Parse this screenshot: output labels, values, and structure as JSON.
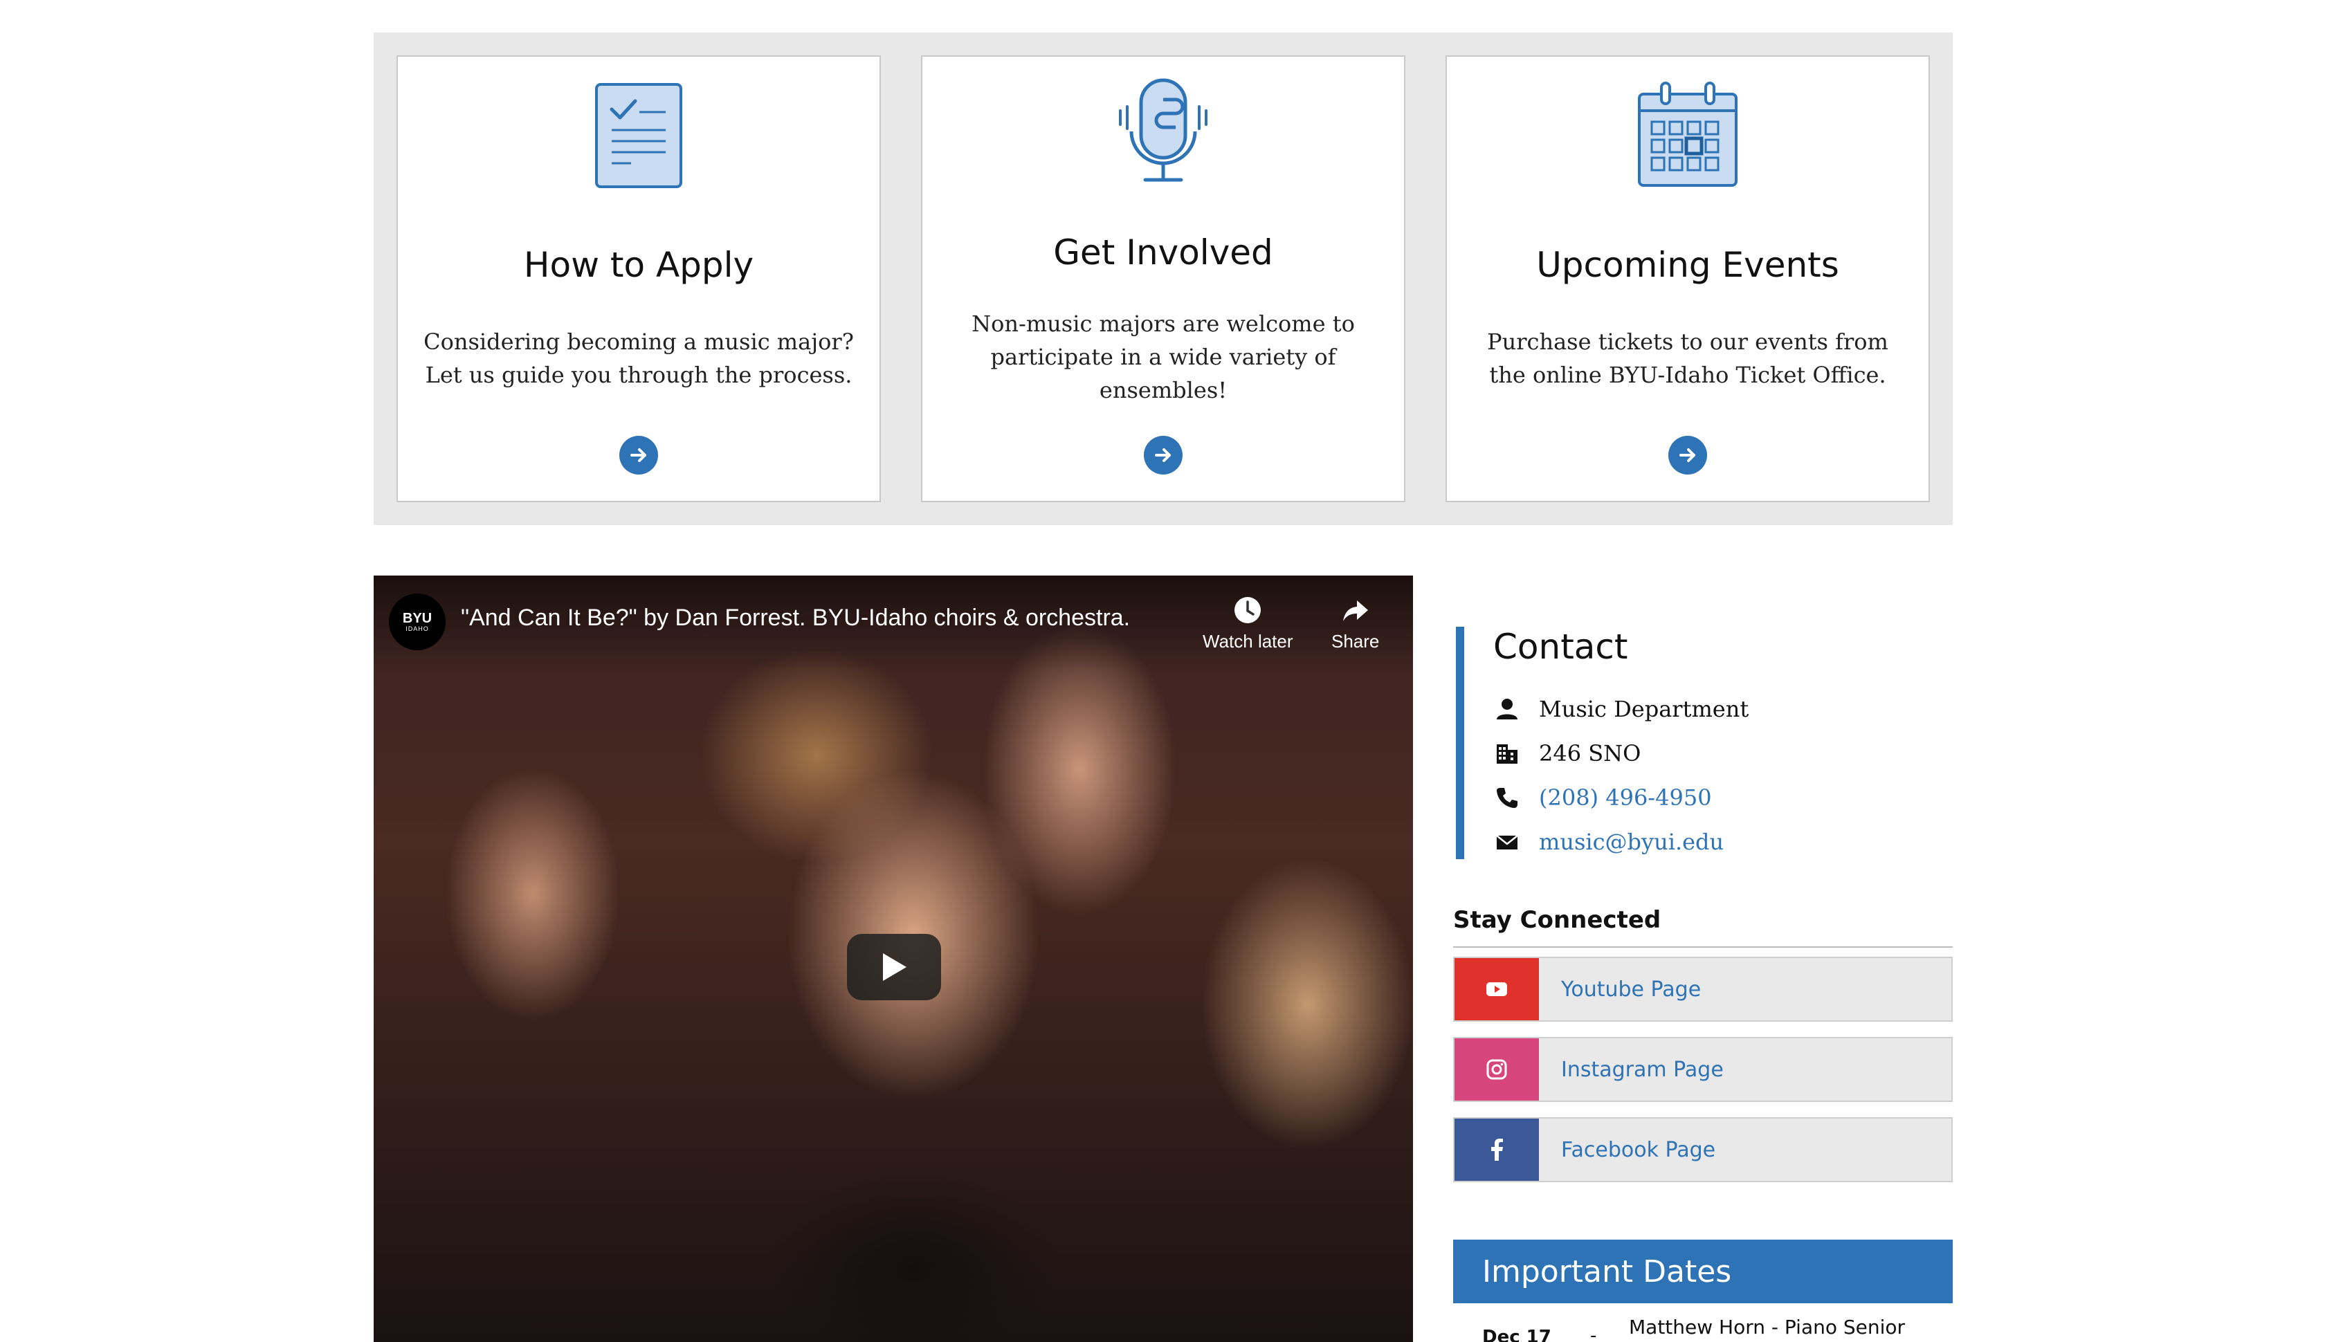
{
  "cards": [
    {
      "title": "How to Apply",
      "description": "Considering becoming a music major? Let us guide you through the process.",
      "icon": "checklist-icon"
    },
    {
      "title": "Get Involved",
      "description": "Non-music majors are welcome to participate in a wide variety of ensembles!",
      "icon": "microphone-icon"
    },
    {
      "title": "Upcoming Events",
      "description": "Purchase tickets to our events from the online BYU-Idaho Ticket Office.",
      "icon": "calendar-icon"
    }
  ],
  "video": {
    "channel_logo_line1": "BYU",
    "channel_logo_line2": "IDAHO",
    "title": "\"And Can It Be?\" by Dan Forrest. BYU-Idaho choirs & orchestra.",
    "watch_later_label": "Watch later",
    "share_label": "Share"
  },
  "contact": {
    "heading": "Contact",
    "department": "Music Department",
    "office": "246 SNO",
    "phone": "(208) 496-4950",
    "email": "music@byui.edu"
  },
  "stay_connected": {
    "heading": "Stay Connected",
    "links": [
      {
        "label": "Youtube Page",
        "icon": "youtube-icon",
        "color": "#e0322b"
      },
      {
        "label": "Instagram Page",
        "icon": "instagram-icon",
        "color": "#d6467d"
      },
      {
        "label": "Facebook Page",
        "icon": "facebook-icon",
        "color": "#3b5998"
      }
    ]
  },
  "important_dates": {
    "heading": "Important Dates",
    "items": [
      {
        "date": "Dec 17",
        "separator": "-",
        "event": "Matthew Horn - Piano Senior"
      }
    ]
  },
  "colors": {
    "accent": "#2e73b6",
    "band_background": "#e8e8e8"
  }
}
